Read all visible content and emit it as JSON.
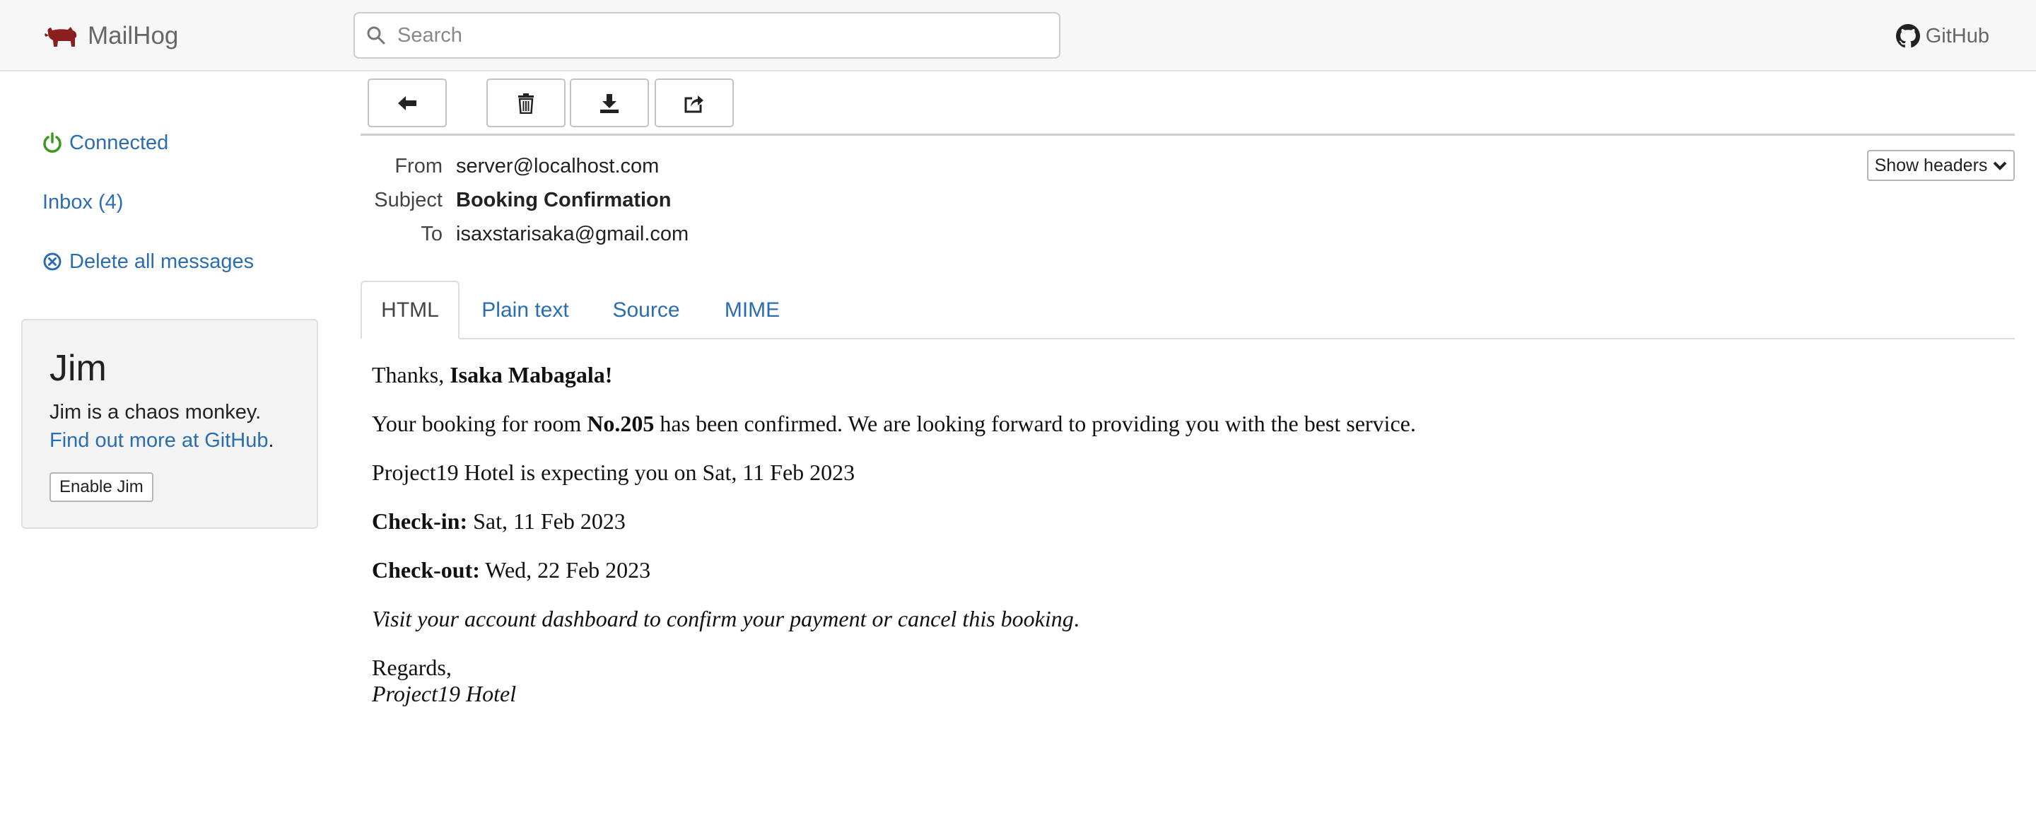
{
  "navbar": {
    "brand": "MailHog",
    "search_placeholder": "Search",
    "github_label": "GitHub"
  },
  "sidebar": {
    "connected_label": "Connected",
    "inbox_label": "Inbox (4)",
    "delete_all_label": "Delete all messages",
    "jim": {
      "title": "Jim",
      "description": "Jim is a chaos monkey.",
      "more_link": "Find out more at GitHub",
      "more_suffix": ".",
      "button": "Enable Jim"
    }
  },
  "toolbar": {
    "icons": [
      "arrow-left-icon",
      "trash-icon",
      "download-icon",
      "share-icon"
    ]
  },
  "message": {
    "headers": {
      "from_label": "From",
      "from_value": "server@localhost.com",
      "subject_label": "Subject",
      "subject_value": "Booking Confirmation",
      "to_label": "To",
      "to_value": "isaxstarisaka@gmail.com"
    },
    "show_headers_label": "Show headers",
    "tabs": [
      "HTML",
      "Plain text",
      "Source",
      "MIME"
    ],
    "active_tab": "HTML",
    "body": {
      "thanks_prefix": "Thanks, ",
      "thanks_name": "Isaka Mabagala!",
      "booking_prefix": "Your booking for room ",
      "booking_room": "No.205",
      "booking_suffix": " has been confirmed. We are looking forward to providing you with the best service.",
      "expecting": "Project19 Hotel is expecting you on Sat, 11 Feb 2023",
      "checkin_label": "Check-in:",
      "checkin_value": " Sat, 11 Feb 2023",
      "checkout_label": "Check-out:",
      "checkout_value": " Wed, 22 Feb 2023",
      "visit_note": "Visit your account dashboard to confirm your payment or cancel this booking",
      "visit_period": ".",
      "regards": "Regards,",
      "signature": "Project19 Hotel"
    }
  },
  "colors": {
    "link": "#2a6db2",
    "connected_icon": "#3c9a1e",
    "delete_icon": "#2a6db2",
    "brand_pig": "#8b1f1f"
  }
}
